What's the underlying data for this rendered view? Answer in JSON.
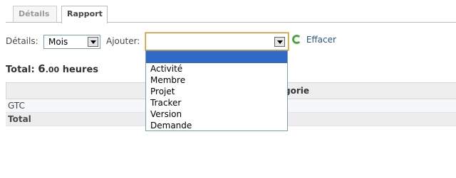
{
  "tabs": [
    {
      "label": "Détails",
      "active": false
    },
    {
      "label": "Rapport",
      "active": true
    }
  ],
  "filters": {
    "details_label": "Détails:",
    "details_value": "Mois",
    "ajouter_label": "Ajouter:",
    "ajouter_value": "",
    "clear_label": "Effacer"
  },
  "total": {
    "label": "Total:",
    "value_int": "6",
    "value_dec": ".00",
    "unit": "heures"
  },
  "table": {
    "column_header_partial": "gorie",
    "rows": [
      {
        "label": "GTC"
      },
      {
        "label": "Total"
      }
    ]
  },
  "dropdown": {
    "options": [
      "",
      "Activité",
      "Membre",
      "Projet",
      "Tracker",
      "Version",
      "Demande"
    ],
    "highlighted_index": 0
  },
  "colors": {
    "highlight": "#316ac5",
    "link": "#2a5685",
    "focus_border": "#cc9933"
  }
}
